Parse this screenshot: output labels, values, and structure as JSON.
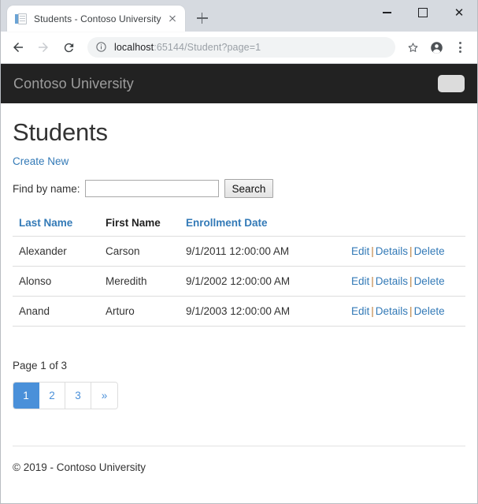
{
  "browser": {
    "tab": {
      "title": "Students - Contoso University",
      "favicon": "document-icon",
      "close_label": "x"
    },
    "new_tab_label": "+",
    "window_controls": {
      "minimize": "–",
      "maximize": "□",
      "close": "✕"
    },
    "nav": {
      "back": "back-arrow",
      "forward": "forward-arrow",
      "reload": "reload-arrow"
    },
    "omnibox": {
      "info_icon": "info-circle-icon",
      "host": "localhost",
      "path": ":65144/Student?page=1",
      "full_url": "localhost:65144/Student?page=1"
    },
    "actions": {
      "bookmark": "star-icon",
      "profile": "profile-avatar-icon",
      "menu": "three-dot-menu-icon"
    }
  },
  "site": {
    "brand": "Contoso University",
    "toggler": "navbar-toggler",
    "footer": "© 2019 - Contoso University"
  },
  "page": {
    "title": "Students",
    "create_new": "Create New",
    "search": {
      "label": "Find by name:",
      "value": "",
      "placeholder": "",
      "button": "Search"
    },
    "table": {
      "headers": [
        {
          "label": "Last Name",
          "sortable": true
        },
        {
          "label": "First Name",
          "sortable": false
        },
        {
          "label": "Enrollment Date",
          "sortable": true
        }
      ],
      "actions": {
        "edit": "Edit",
        "details": "Details",
        "delete": "Delete",
        "separator": "|"
      },
      "rows": [
        {
          "last_name": "Alexander",
          "first_name": "Carson",
          "enrollment_date": "9/1/2011 12:00:00 AM"
        },
        {
          "last_name": "Alonso",
          "first_name": "Meredith",
          "enrollment_date": "9/1/2002 12:00:00 AM"
        },
        {
          "last_name": "Anand",
          "first_name": "Arturo",
          "enrollment_date": "9/1/2003 12:00:00 AM"
        }
      ]
    },
    "pagination": {
      "info": "Page 1 of 3",
      "current_page": 1,
      "total_pages": 3,
      "items": [
        {
          "label": "1",
          "active": true
        },
        {
          "label": "2",
          "active": false
        },
        {
          "label": "3",
          "active": false
        },
        {
          "label": "»",
          "active": false
        }
      ]
    }
  },
  "colors": {
    "navbar_bg": "#222222",
    "brand_text": "#9d9d9d",
    "link": "#337ab7",
    "pagination_active": "#4a90d9",
    "table_border": "#dddddd"
  }
}
